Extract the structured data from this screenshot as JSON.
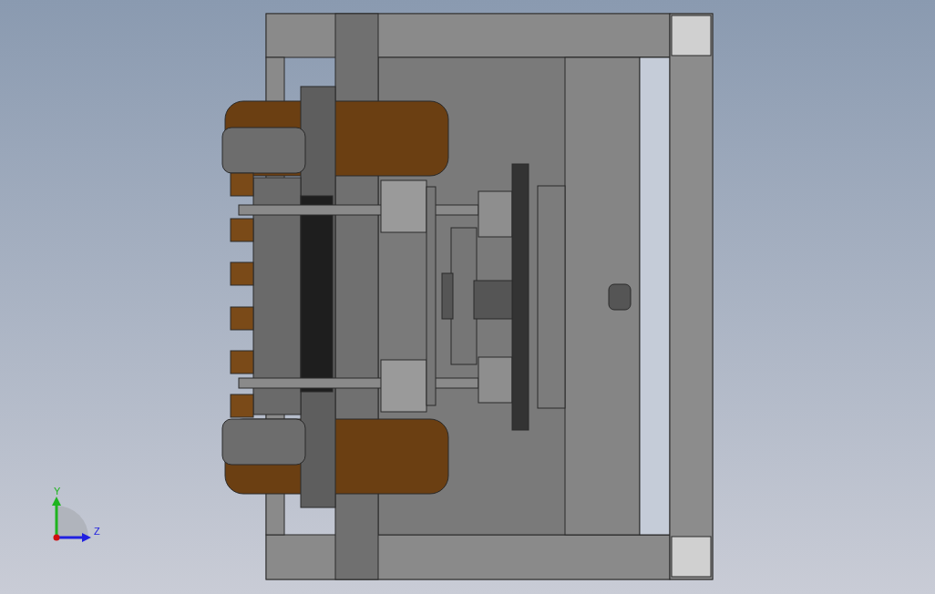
{
  "triad": {
    "axes": [
      {
        "kind": "vertical",
        "label": "Y",
        "color": "#1fb41f"
      },
      {
        "kind": "horizontal",
        "label": "Z",
        "color": "#2020e0"
      }
    ]
  }
}
